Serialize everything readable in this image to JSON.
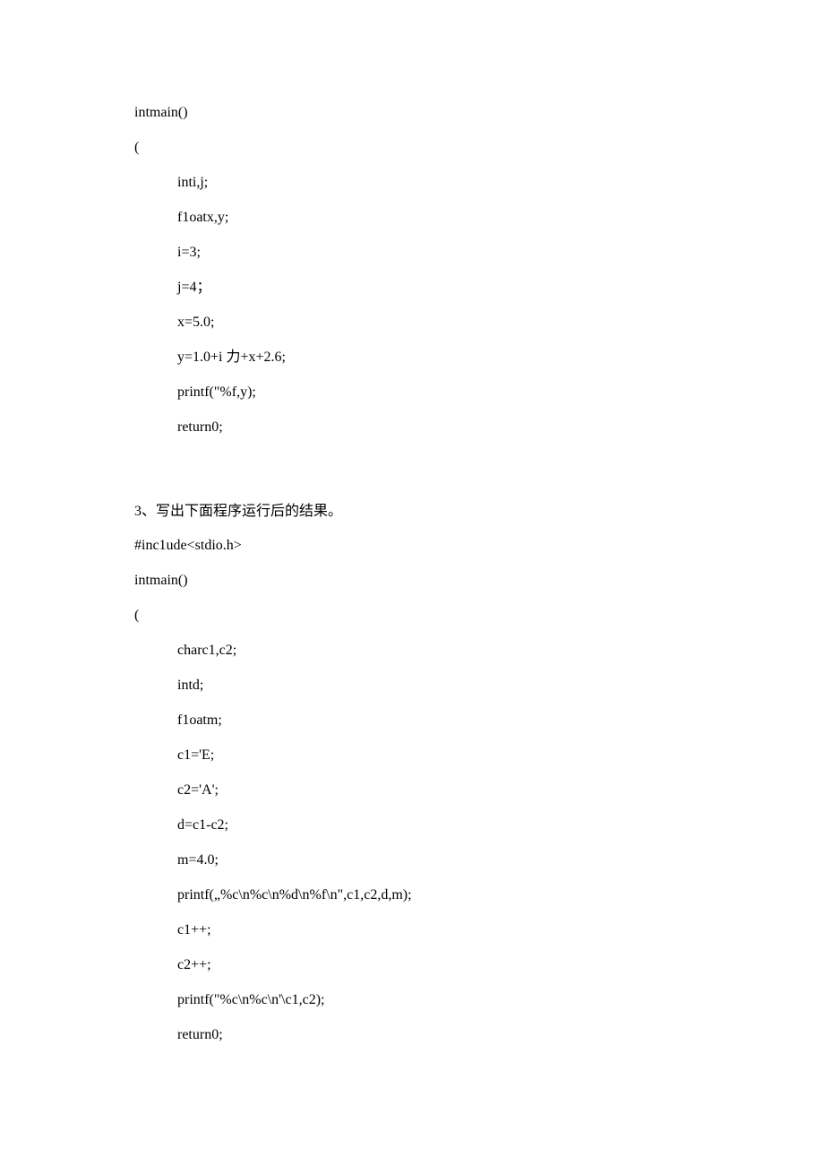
{
  "block1": {
    "l1": "intmain()",
    "l2": "(",
    "l3": "inti,j;",
    "l4": "f1oatx,y;",
    "l5": "i=3;",
    "l6": "j=4；",
    "l7": "x=5.0;",
    "l8": "y=1.0+i 力+x+2.6;",
    "l9": "printf(\"%f,y);",
    "l10": "return0;"
  },
  "q3": {
    "heading": "3、写出下面程序运行后的结果。"
  },
  "block2": {
    "l1": "#inc1ude<stdio.h>",
    "l2": "intmain()",
    "l3": "(",
    "l4": "charc1,c2;",
    "l5": "intd;",
    "l6": "f1oatm;",
    "l7": "c1='E;",
    "l8": "c2='A';",
    "l9": "d=c1-c2;",
    "l10": "m=4.0;",
    "l11": "printf(„%c\\n%c\\n%d\\n%f\\n\",c1,c2,d,m);",
    "l12": "c1++;",
    "l13": "c2++;",
    "l14": "printf(\"%c\\n%c\\n'\\c1,c2);",
    "l15": "return0;"
  }
}
